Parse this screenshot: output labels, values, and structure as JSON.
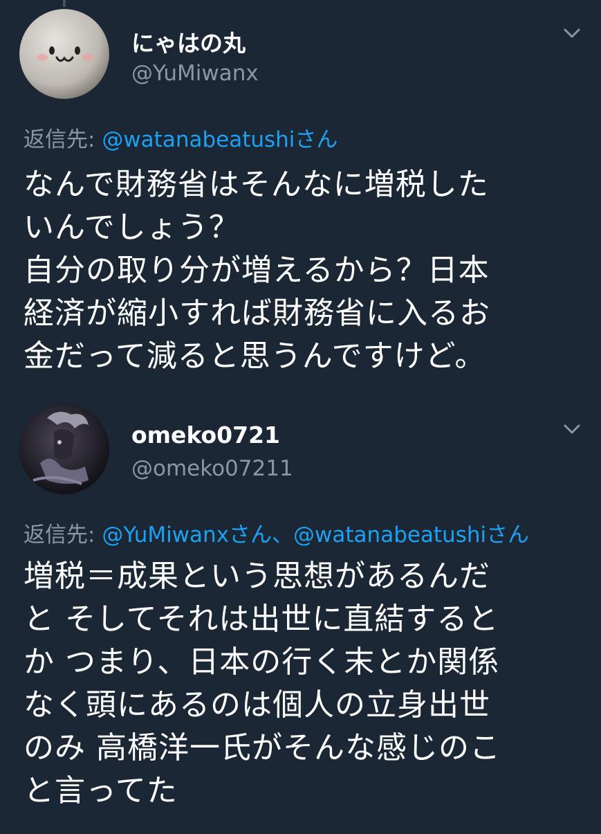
{
  "tweets": [
    {
      "display_name": "にゃはの丸",
      "handle": "@YuMiwanx",
      "reply_prefix": "返信先: ",
      "reply_mentions": "@watanabeatushiさん",
      "text": "なんで財務省はそんなに増税した\nいんでしょう？\n自分の取り分が増えるから？日本\n経済が縮小すれば財務省に入るお\n金だって減ると思うんですけど。",
      "avatar_icon": "smiley-face-avatar",
      "menu_icon": "chevron-down-icon"
    },
    {
      "display_name": "omeko0721",
      "handle": "@omeko07211",
      "reply_prefix": "返信先: ",
      "reply_mentions": "@YuMiwanxさん、@watanabeatushiさん",
      "text": "増税＝成果という思想があるんだ\nと そしてそれは出世に直結すると\nか つまり、日本の行く末とか関係\nなく頭にあるのは個人の立身出世\nのみ 高橋洋一氏がそんな感じのこ\nと言ってた",
      "avatar_icon": "dark-figure-avatar",
      "menu_icon": "chevron-down-icon"
    }
  ],
  "colors": {
    "background": "#1b2735",
    "text_primary": "#ffffff",
    "text_secondary": "#8899a6",
    "link": "#1da1f2"
  }
}
